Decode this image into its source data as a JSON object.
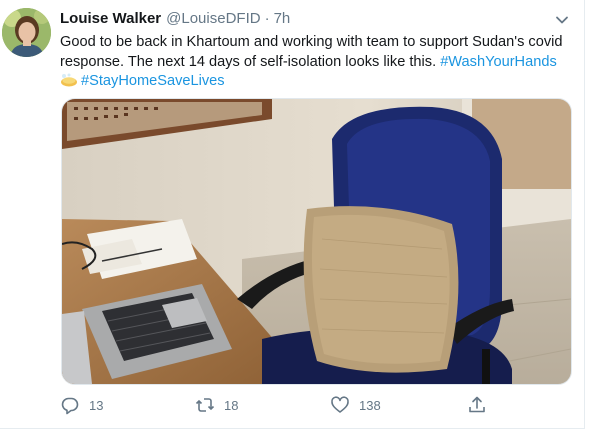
{
  "tweet": {
    "display_name": "Louise Walker",
    "handle": "@LouiseDFID",
    "separator": "·",
    "time": "7h",
    "text_part1": "Good to be back in Khartoum and working with team to support Sudan's covid response.  The next 14 days of self-isolation looks like this. ",
    "hashtag1": "#WashYourHands",
    "hashtag2": "#StayHomeSaveLives"
  },
  "actions": {
    "reply_count": "13",
    "retweet_count": "18",
    "like_count": "138"
  },
  "icons": {
    "caret": "chevron-down-icon",
    "emoji": "soap-emoji-icon",
    "reply": "reply-icon",
    "retweet": "retweet-icon",
    "like": "heart-icon",
    "share": "share-icon"
  },
  "colors": {
    "hashtag": "#1b95e0",
    "muted": "#657786",
    "text": "#14171a"
  }
}
